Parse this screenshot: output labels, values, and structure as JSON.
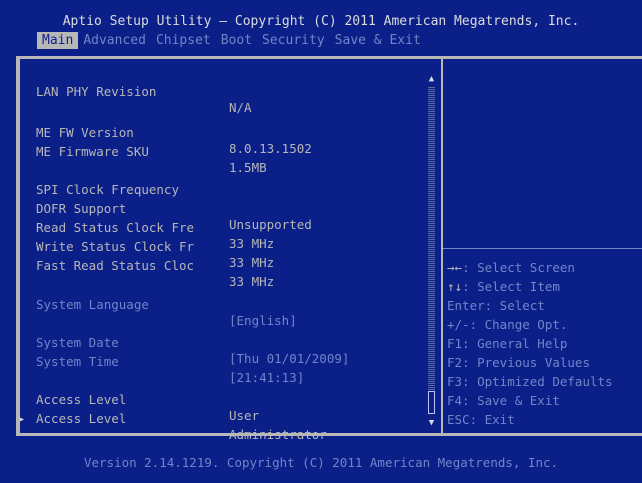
{
  "header": {
    "title": "Aptio Setup Utility – Copyright (C) 2011 American Megatrends, Inc."
  },
  "tabs": [
    {
      "label": "Main",
      "active": true
    },
    {
      "label": "Advanced",
      "active": false
    },
    {
      "label": "Chipset",
      "active": false
    },
    {
      "label": "Boot",
      "active": false
    },
    {
      "label": "Security",
      "active": false
    },
    {
      "label": "Save & Exit",
      "active": false
    }
  ],
  "settings": [
    {
      "label": "LAN PHY Revision",
      "value": "N/A"
    },
    {
      "label": "ME FW Version",
      "value": "8.0.13.1502"
    },
    {
      "label": "ME Firmware SKU",
      "value": "1.5MB"
    },
    {
      "label": "SPI Clock Frequency",
      "value": ""
    },
    {
      "label": "DOFR Support",
      "value": "Unsupported"
    },
    {
      "label": "Read Status Clock Fre",
      "value": "33 MHz"
    },
    {
      "label": "Write Status Clock Fr",
      "value": "33 MHz"
    },
    {
      "label": "Fast Read Status Cloc",
      "value": "33 MHz"
    },
    {
      "label": "System Language",
      "value": "[English]"
    },
    {
      "label": "System Date",
      "value": "[Thu 01/01/2009]"
    },
    {
      "label": "System Time",
      "value": "[21:41:13]"
    },
    {
      "label": "Access Level",
      "value": "User"
    },
    {
      "label": "Access Level",
      "value": "Administrator"
    }
  ],
  "help": [
    {
      "key": "→←",
      "text": ": Select Screen"
    },
    {
      "key": "↑↓",
      "text": ": Select Item"
    },
    {
      "key": "",
      "text": "Enter: Select"
    },
    {
      "key": "",
      "text": "+/-: Change Opt."
    },
    {
      "key": "",
      "text": "F1: General Help"
    },
    {
      "key": "",
      "text": "F2: Previous Values"
    },
    {
      "key": "",
      "text": "F3: Optimized Defaults"
    },
    {
      "key": "",
      "text": "F4: Save & Exit"
    },
    {
      "key": "",
      "text": "ESC: Exit"
    }
  ],
  "scrollbar": {
    "up_arrow": "▲",
    "down_arrow": "▼"
  },
  "cursor_glyph": "▸",
  "footer": {
    "text": "Version 2.14.1219. Copyright (C) 2011 American Megatrends, Inc."
  }
}
